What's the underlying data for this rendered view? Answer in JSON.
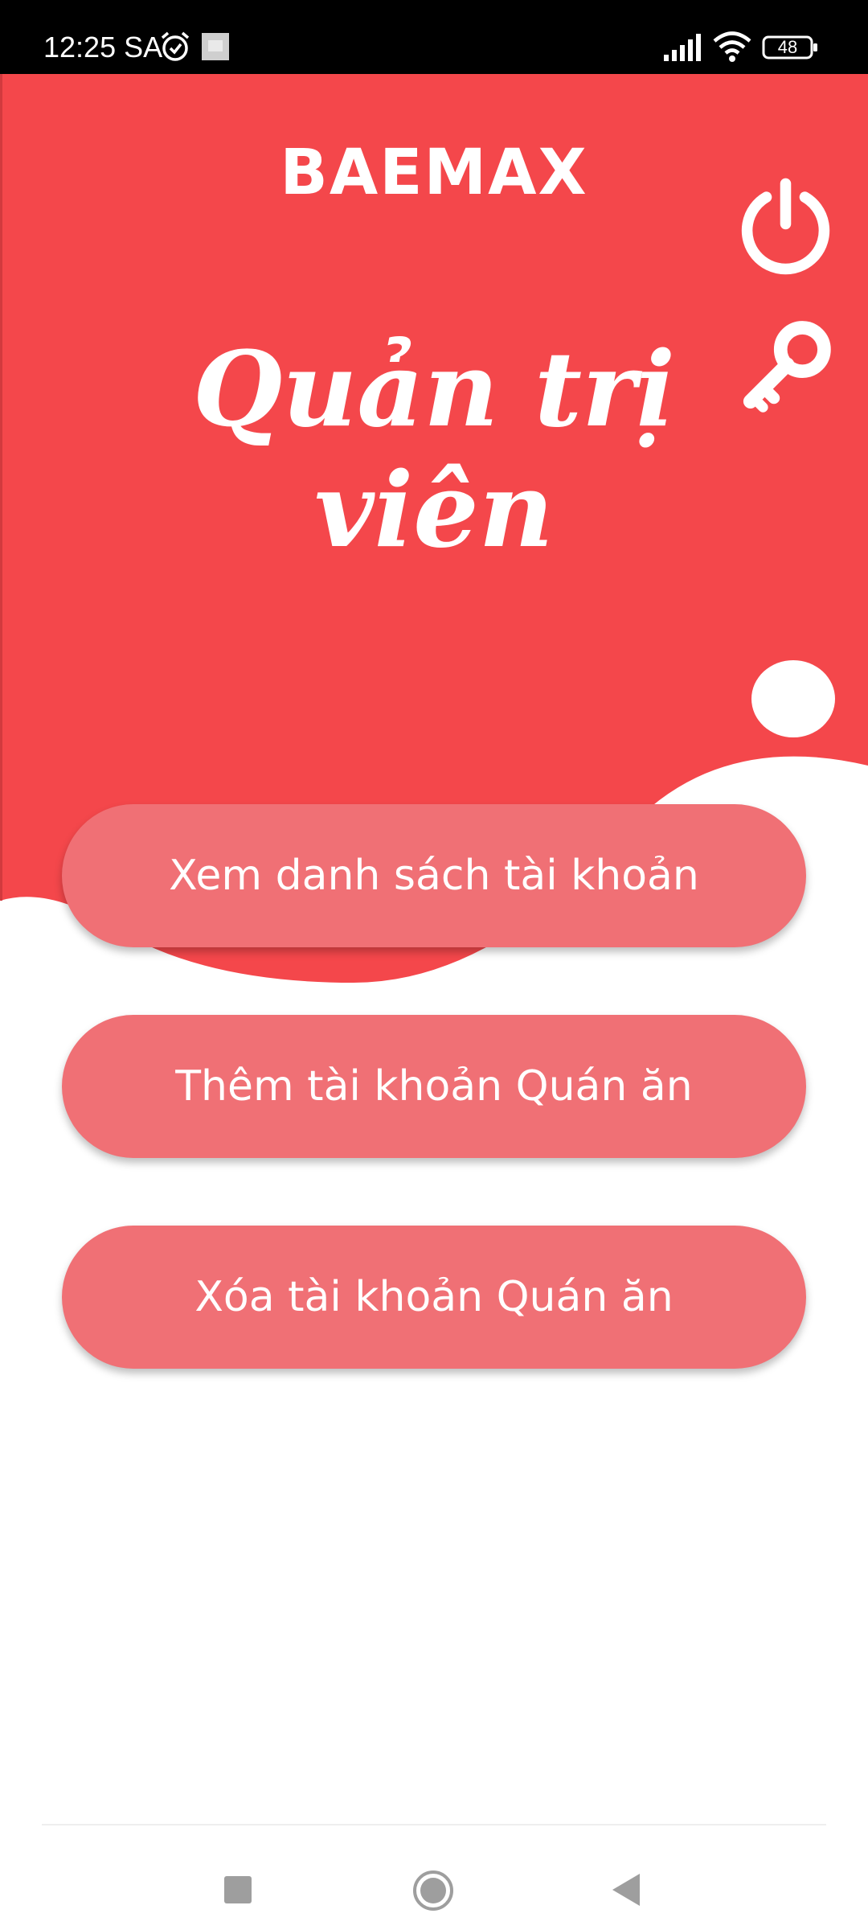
{
  "status_bar": {
    "time": "12:25 SA",
    "battery": "48",
    "icons": [
      "alarm-icon",
      "notification-icon",
      "signal-icon",
      "wifi-icon",
      "battery-icon"
    ]
  },
  "header": {
    "brand": "BAEMAX",
    "title": "Quản trị viên",
    "actions": [
      {
        "icon": "power-icon"
      },
      {
        "icon": "key-icon"
      }
    ]
  },
  "menu": {
    "items": [
      {
        "label": "Xem danh sách tài khoản"
      },
      {
        "label": "Thêm tài khoản Quán ăn"
      },
      {
        "label": "Xóa tài khoản Quán ăn"
      }
    ]
  },
  "nav_bar": {
    "icons": [
      "recent-apps-icon",
      "home-icon",
      "back-icon"
    ]
  },
  "colors": {
    "header_red": "#f4474b",
    "button_pink": "#f07075",
    "text_white": "#ffffff",
    "status_bar": "#000000"
  }
}
